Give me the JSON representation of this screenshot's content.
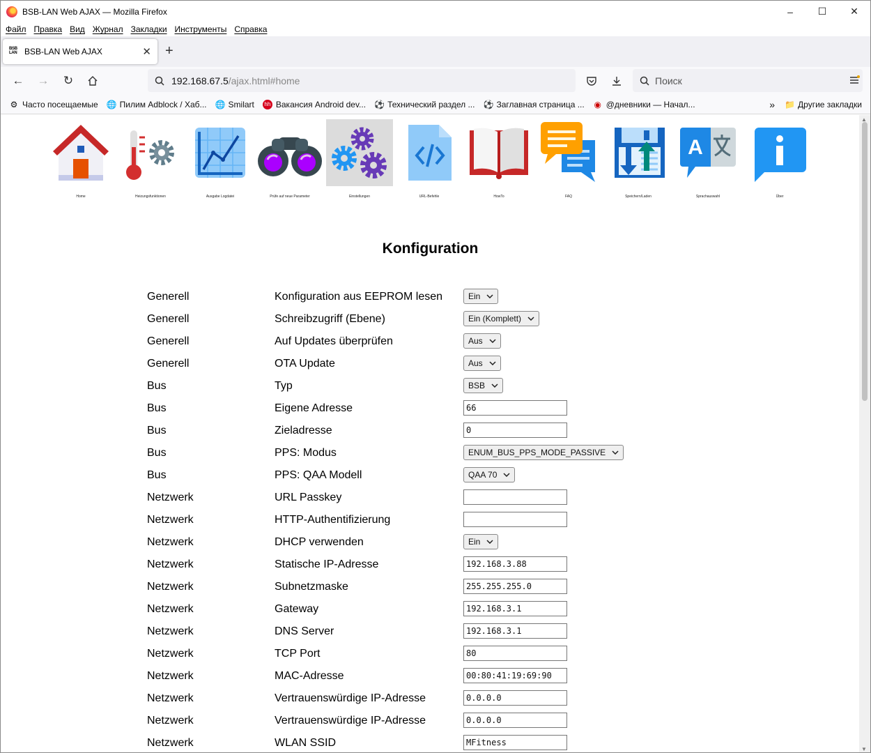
{
  "window": {
    "title": "BSB-LAN Web AJAX — Mozilla Firefox"
  },
  "menu": [
    "Файл",
    "Правка",
    "Вид",
    "Журнал",
    "Закладки",
    "Инструменты",
    "Справка"
  ],
  "tab": {
    "icon_text": "BSB LAN",
    "title": "BSB-LAN Web AJAX"
  },
  "url": {
    "host": "192.168.67.5",
    "path": "/ajax.html#home"
  },
  "search": {
    "placeholder": "Поиск"
  },
  "bookmarks": [
    {
      "icon": "gear",
      "label": "Часто посещаемые"
    },
    {
      "icon": "globe",
      "label": "Пилим Adblock / Хаб..."
    },
    {
      "icon": "globe",
      "label": "Smilart"
    },
    {
      "icon": "hh",
      "label": "Вакансия Android dev..."
    },
    {
      "icon": "ball",
      "label": "Технический раздел ..."
    },
    {
      "icon": "ball",
      "label": "Заглавная страница ..."
    },
    {
      "icon": "diary",
      "label": "@дневники — Начал..."
    }
  ],
  "other_bookmarks": "Другие закладки",
  "nav_icons": [
    {
      "name": "home",
      "label": "Home"
    },
    {
      "name": "heating",
      "label": "Heizungsfunktionen"
    },
    {
      "name": "log",
      "label": "Ausgabe Logdatei"
    },
    {
      "name": "check",
      "label": "Prüfe auf neue Parameter"
    },
    {
      "name": "settings",
      "label": "Einstellungen"
    },
    {
      "name": "url",
      "label": "URL-Befehle"
    },
    {
      "name": "howto",
      "label": "HowTo"
    },
    {
      "name": "faq",
      "label": "FAQ"
    },
    {
      "name": "save",
      "label": "Speichern/Laden"
    },
    {
      "name": "lang",
      "label": "Sprachauswahl"
    },
    {
      "name": "about",
      "label": "Über"
    }
  ],
  "page_title": "Konfiguration",
  "config": [
    {
      "category": "Generell",
      "name": "Konfiguration aus EEPROM lesen",
      "type": "select",
      "value": "Ein"
    },
    {
      "category": "Generell",
      "name": "Schreibzugriff (Ebene)",
      "type": "select",
      "value": "Ein (Komplett)"
    },
    {
      "category": "Generell",
      "name": "Auf Updates überprüfen",
      "type": "select",
      "value": "Aus"
    },
    {
      "category": "Generell",
      "name": "OTA Update",
      "type": "select",
      "value": "Aus"
    },
    {
      "category": "Bus",
      "name": "Typ",
      "type": "select",
      "value": "BSB"
    },
    {
      "category": "Bus",
      "name": "Eigene Adresse",
      "type": "input",
      "value": "66"
    },
    {
      "category": "Bus",
      "name": "Zieladresse",
      "type": "input",
      "value": "0"
    },
    {
      "category": "Bus",
      "name": "PPS: Modus",
      "type": "select",
      "value": "ENUM_BUS_PPS_MODE_PASSIVE"
    },
    {
      "category": "Bus",
      "name": "PPS: QAA Modell",
      "type": "select",
      "value": "QAA 70"
    },
    {
      "category": "Netzwerk",
      "name": "URL Passkey",
      "type": "input",
      "value": ""
    },
    {
      "category": "Netzwerk",
      "name": "HTTP-Authentifizierung",
      "type": "input",
      "value": ""
    },
    {
      "category": "Netzwerk",
      "name": "DHCP verwenden",
      "type": "select",
      "value": "Ein"
    },
    {
      "category": "Netzwerk",
      "name": "Statische IP-Adresse",
      "type": "input",
      "value": "192.168.3.88"
    },
    {
      "category": "Netzwerk",
      "name": "Subnetzmaske",
      "type": "input",
      "value": "255.255.255.0"
    },
    {
      "category": "Netzwerk",
      "name": "Gateway",
      "type": "input",
      "value": "192.168.3.1"
    },
    {
      "category": "Netzwerk",
      "name": "DNS Server",
      "type": "input",
      "value": "192.168.3.1"
    },
    {
      "category": "Netzwerk",
      "name": "TCP Port",
      "type": "input",
      "value": "80"
    },
    {
      "category": "Netzwerk",
      "name": "MAC-Adresse",
      "type": "input",
      "value": "00:80:41:19:69:90"
    },
    {
      "category": "Netzwerk",
      "name": "Vertrauenswürdige IP-Adresse",
      "type": "input",
      "value": "0.0.0.0"
    },
    {
      "category": "Netzwerk",
      "name": "Vertrauenswürdige IP-Adresse",
      "type": "input",
      "value": "0.0.0.0"
    },
    {
      "category": "Netzwerk",
      "name": "WLAN SSID",
      "type": "input",
      "value": "MFitness"
    }
  ]
}
